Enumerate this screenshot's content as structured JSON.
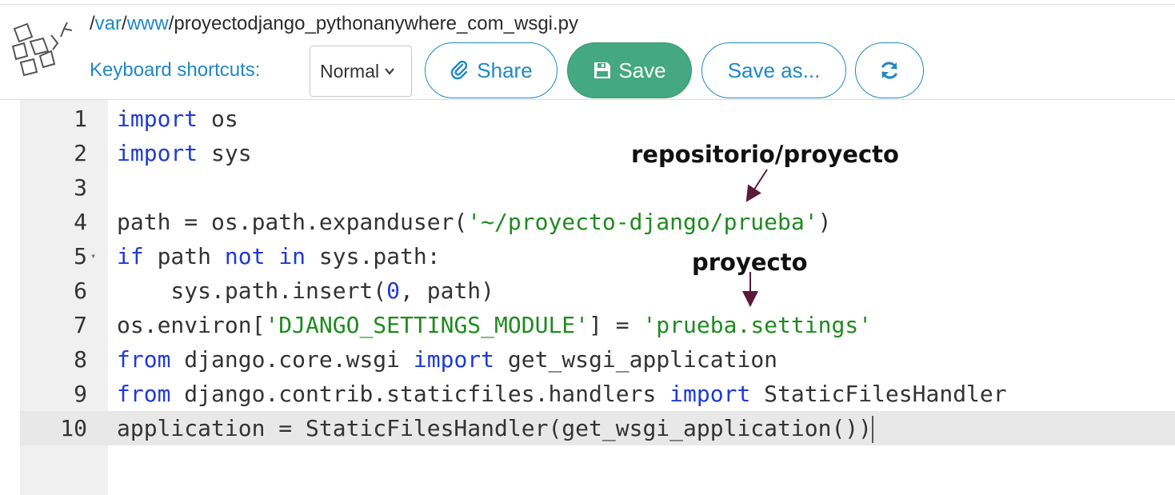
{
  "header": {
    "path_segments": [
      "/",
      "var",
      "/",
      "www",
      "/proyectodjango_pythonanywhere_com_wsgi.py"
    ],
    "keyboard_label": "Keyboard shortcuts:",
    "keyboard_mode": "Normal",
    "share_label": "Share",
    "save_label": "Save",
    "saveas_label": "Save as...",
    "reload_icon": "refresh-icon"
  },
  "editor": {
    "line_numbers": [
      "1",
      "2",
      "3",
      "4",
      "5",
      "6",
      "7",
      "8",
      "9",
      "10"
    ],
    "active_line": "10",
    "foldable_line": "5",
    "tokens": {
      "l1_kw": "import",
      "l1_rest": " os",
      "l2_kw": "import",
      "l2_rest": " sys",
      "l4_a": "path = os.path.expanduser(",
      "l4_str": "'~/proyecto-django/prueba'",
      "l4_b": ")",
      "l5_kw1": "if",
      "l5_a": " path ",
      "l5_kw2": "not",
      "l5_b": " ",
      "l5_kw3": "in",
      "l5_c": " sys.path:",
      "l6_a": "    sys.path.insert(",
      "l6_num": "0",
      "l6_b": ", path)",
      "l7_a": "os.environ[",
      "l7_str1": "'DJANGO_SETTINGS_MODULE'",
      "l7_b": "] = ",
      "l7_str2": "'prueba.settings'",
      "l8_kw1": "from",
      "l8_a": " django.core.wsgi ",
      "l8_kw2": "import",
      "l8_b": " get_wsgi_application",
      "l9_kw1": "from",
      "l9_a": " django.contrib.staticfiles.handlers ",
      "l9_kw2": "import",
      "l9_b": " StaticFilesHandler",
      "l10_a": "application = StaticFilesHandler(get_wsgi_application())"
    }
  },
  "annotations": {
    "repo": "repositorio/proyecto",
    "project": "proyecto"
  },
  "colors": {
    "link": "#1f88c4",
    "save_bg": "#44a882",
    "keyword": "#1f3ad6",
    "string": "#1f8a1f"
  }
}
